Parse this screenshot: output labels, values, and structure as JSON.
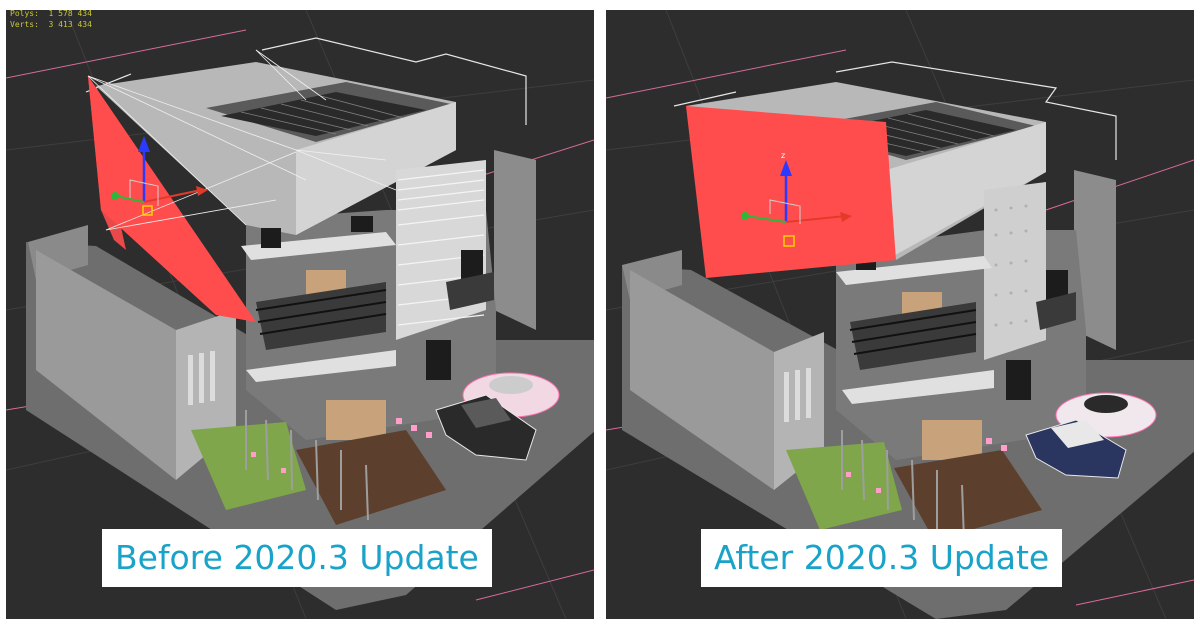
{
  "viewport_stats": {
    "polys_label": "Polys:",
    "polys_value": "1 578 434",
    "verts_label": "Verts:",
    "verts_value": "3 413 434"
  },
  "panels": {
    "before": {
      "caption": "Before 2020.3 Update"
    },
    "after": {
      "caption": "After 2020.3 Update"
    }
  },
  "gizmo_axes": {
    "z": "z"
  },
  "colors": {
    "viewport_bg": "#2d2d2d",
    "light_plane": "#ff4d4d",
    "caption_text": "#1aa3c8",
    "wire_pink": "#ff9ec8"
  }
}
